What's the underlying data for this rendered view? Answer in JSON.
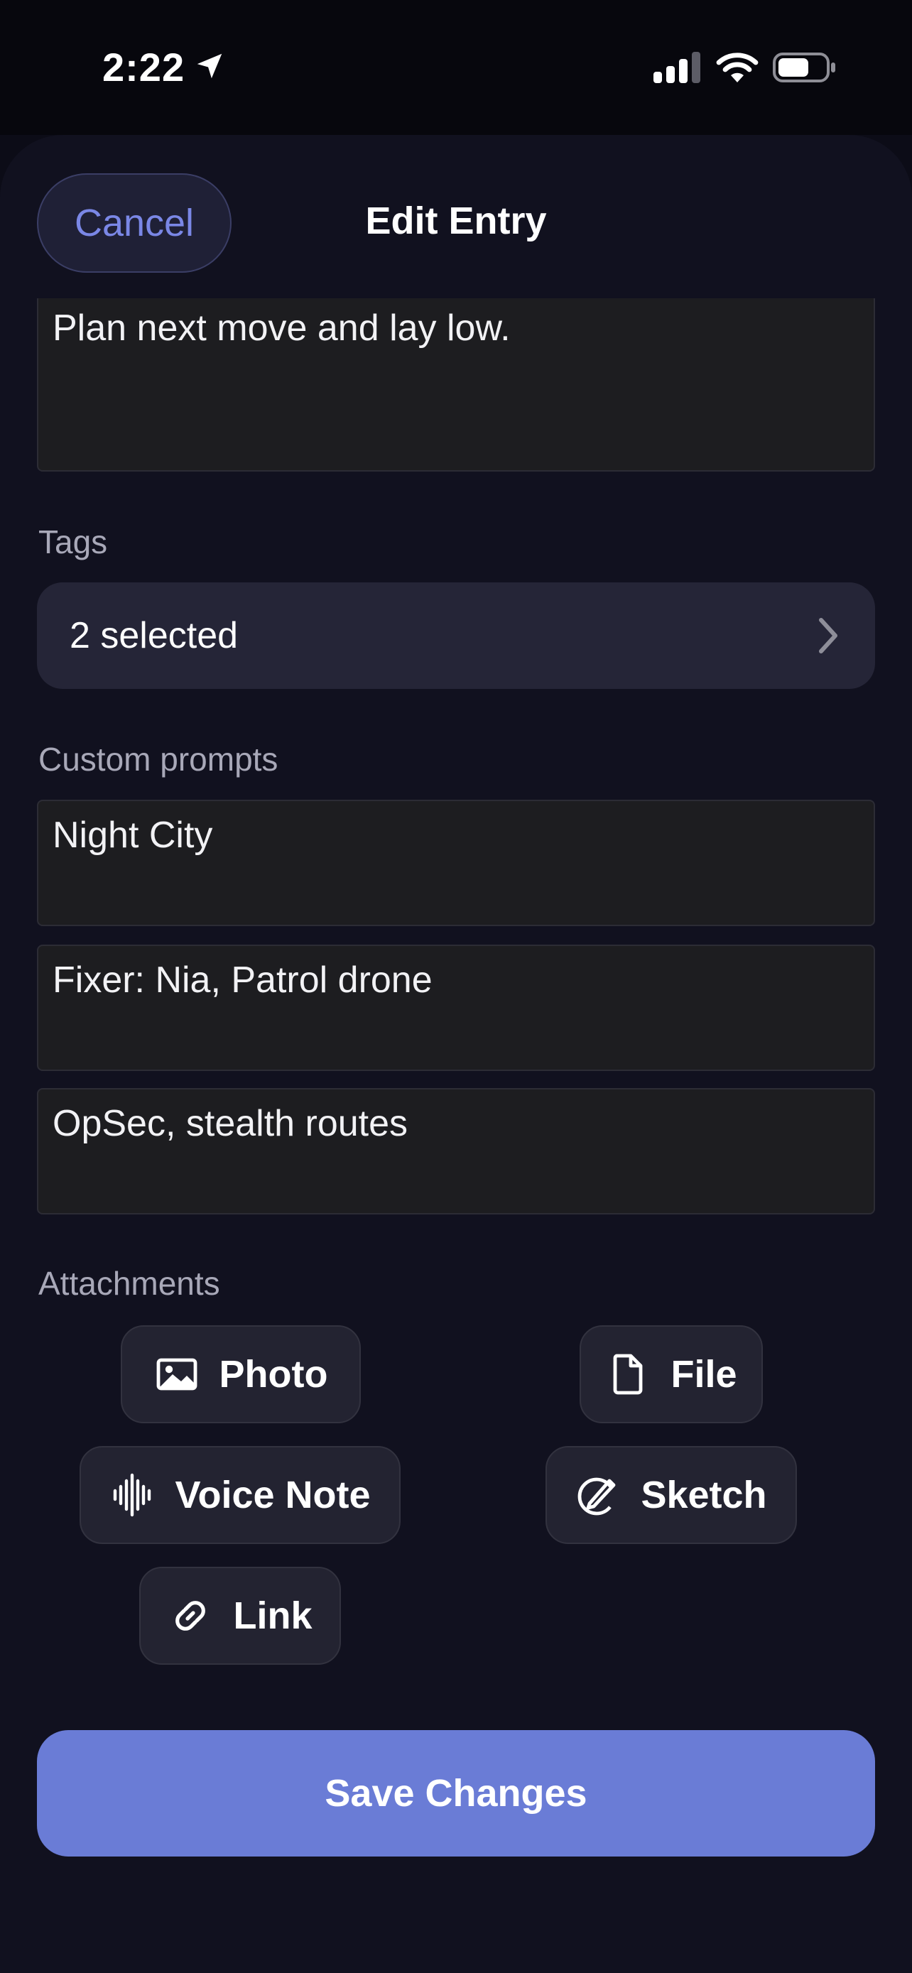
{
  "status_bar": {
    "time": "2:22"
  },
  "header": {
    "cancel_label": "Cancel",
    "title": "Edit Entry"
  },
  "notes": {
    "value": "Plan next move and lay low."
  },
  "tags": {
    "label": "Tags",
    "value": "2 selected"
  },
  "custom_prompts": {
    "label": "Custom prompts",
    "items": [
      "Night City",
      "Fixer: Nia, Patrol drone",
      "OpSec, stealth routes"
    ]
  },
  "attachments": {
    "label": "Attachments",
    "photo_label": "Photo",
    "file_label": "File",
    "voice_label": "Voice Note",
    "sketch_label": "Sketch",
    "link_label": "Link"
  },
  "save_label": "Save Changes",
  "colors": {
    "accent": "#6a7cd6",
    "cancel_text": "#7a87e6",
    "background": "#11111f"
  }
}
